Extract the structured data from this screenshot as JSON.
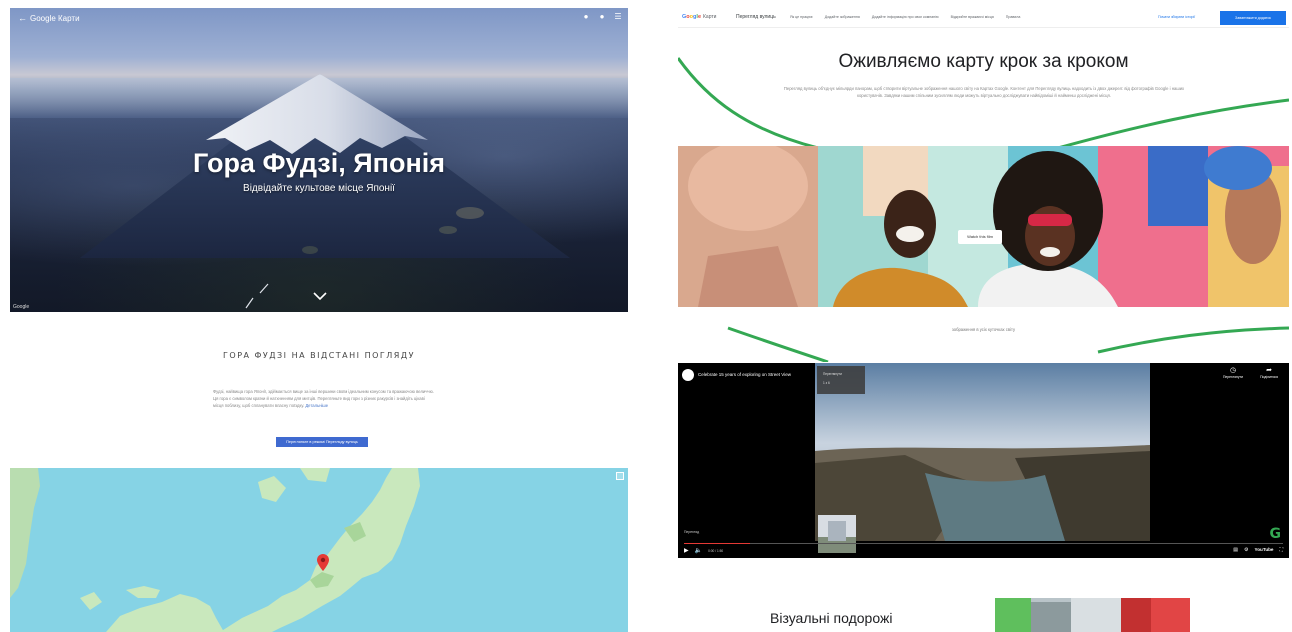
{
  "left": {
    "hero": {
      "back_icon": "arrow-back-icon",
      "brand": "Google Карти",
      "title": "Гора Фудзі, Японія",
      "subtitle": "Відвідайте культове місце Японії",
      "scroll_icon": "chevron-down-icon",
      "actions": [
        "share-icon",
        "help-icon",
        "menu-icon"
      ],
      "credit": "Google"
    },
    "section": {
      "title": "ГОРА ФУДЗІ НА ВІДСТАНІ ПОГЛЯДУ",
      "paragraph": "Фудзі, найвища гора Японії, здіймається вище за інші вершини своїм ідеальним конусом та вражаючою величчю. Ця гора є символом країни й натхненням для митців. Перегляньте вид гори з різних ракурсів і знайдіть цікаві місця поблизу, щоб спланувати власну поїздку.",
      "link": "Детальніше",
      "button": "Перегляньте в режимі Перегляду вулиць"
    },
    "map": {
      "expand_icon": "expand-icon",
      "pin_icon": "map-pin-icon"
    }
  },
  "right": {
    "nav": {
      "logo_letters": [
        "G",
        "o",
        "o",
        "g",
        "l",
        "e"
      ],
      "product": "Карти",
      "section": "Перегляд вулиць",
      "links": [
        "Як це працює",
        "Додайте зображення",
        "Додайте інформацію про своє компанію",
        "Відкрийте вражаючі місця",
        "Правила"
      ],
      "cta_link": "Почати збирати історії",
      "cta_button": "Завантажити додаток"
    },
    "heading": "Оживляємо карту крок за кроком",
    "intro": "Перегляд вулиць об'єднує мільярди панорам, щоб створити віртуальне зображення нашого світу на Картах Google. Контент для Перегляду вулиць надходить із двох джерел: від фотографів Google і наших користувачів. Завдяки нашим спільним зусиллям люди можуть віртуально досліджувати найвідоміші й найменш досліджені місця.",
    "photo": {
      "tag": "Watch this film"
    },
    "caption": "зображення в усіх куточках світу",
    "video": {
      "title": "Celebrate 15 years of exploring on Street View",
      "channel_icon": "google-channel-icon",
      "actions": [
        {
          "icon": "clock-icon",
          "label": "Переглянути"
        },
        {
          "icon": "share-icon",
          "label": "Поділитися"
        }
      ],
      "menu_items": [
        "Переглянути",
        "1 з 6"
      ],
      "label": "Перегляд",
      "time": "0:00 / 1:50",
      "progress": 0.11,
      "wordmark": "YouTube",
      "g_logo": "G"
    },
    "bottom_title": "Візуальні подорожі"
  },
  "colors": {
    "accent_blue": "#1a73e8",
    "map_water": "#86d3e5",
    "green_curve": "#34a853",
    "progress_red": "#e53935"
  }
}
